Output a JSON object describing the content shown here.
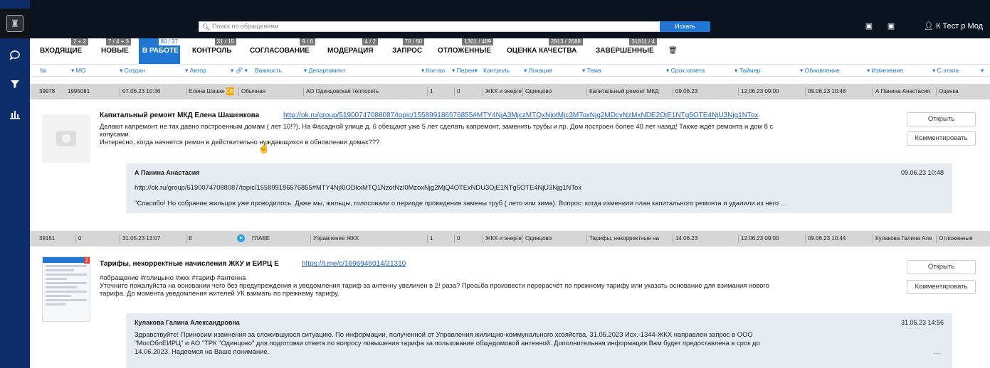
{
  "search": {
    "placeholder": "Поиск по обращениям",
    "button": "Искать"
  },
  "user": {
    "name": "К Тест р Мод"
  },
  "tabs": [
    {
      "label": "ВХОДЯЩИЕ",
      "badge": "2 + 2"
    },
    {
      "label": "НОВЫЕ",
      "badge": "7 / 4 + 3"
    },
    {
      "label": "В РАБОТЕ",
      "badge": "80 / 27",
      "active": true
    },
    {
      "label": "КОНТРОЛЬ",
      "badge": "31 / 15"
    },
    {
      "label": "СОГЛАСОВАНИЕ",
      "badge": "9 / 6"
    },
    {
      "label": "МОДЕРАЦИЯ",
      "badge": "4 / 2"
    },
    {
      "label": "ЗАПРОС",
      "badge": "70 / 60"
    },
    {
      "label": "ОТЛОЖЕННЫЕ",
      "badge": "1301 / 489"
    },
    {
      "label": "ОЦЕНКА КАЧЕСТВА",
      "badge": "2913 / 2688"
    },
    {
      "label": "ЗАВЕРШЕННЫЕ",
      "badge": "31811 / 4"
    }
  ],
  "columns": [
    "№",
    "МО",
    "Создан",
    "Автор",
    "Важность",
    "Департамент",
    "Кол-во",
    "Перен",
    "Контроль",
    "Локация",
    "Тема",
    "Срок ответа",
    "Таймер",
    "Обновление",
    "Изменение",
    "С этапа"
  ],
  "rows": [
    {
      "cells": [
        "39978",
        "1995081",
        "07.06.23 10:36",
        "Елена Шашен",
        "Обычная",
        "АО Одинцовская теплосеть",
        "1",
        "0",
        "ЖКХ и энергет",
        "Одинцово",
        "Капитальный ремонт МКД",
        "09.06.23",
        "12.06.23 09:00",
        "09.06.23 10:48",
        "А Панина Анастасия",
        "Оценка"
      ],
      "detail": {
        "title": "Капитальный ремонт МКД   Елена Шашенкова",
        "link": "http://ok.ru/group/51900747088087/topic/155899186576855#MTY4NjA3MjczMTQxNjotMjc3MToxNjg2MDcyNzMxNDE2OjE1NTg5OTE4NjU3Njg1NTox",
        "text1": "Делают капремонт не так давно построенным домам ( лет 10!?). На Фасадной улице д. 6 обещают уже 5 лет сделать капремонт, заменить трубы и пр. Дом построен более 40 лет назад! Также ждёт ремонта и дом 8 с",
        "text2": "копусами.",
        "text3": "Интересно, когда начнется ремон в действительно нуждающихся в обновлении домах???",
        "reply_author": "А Панина Анастасия",
        "reply_date": "09.06.23 10:48",
        "reply_link": "http://ok.ru/group/51900747088087/topic/155899186576855#MTY4NjI0ODkxMTQ1NzotNzI0MzoxNjg2MjQ4OTExNDU3OjE1NTg5OTE4NjU3Njg1NTox",
        "reply_text": "\"Спасибо! Но собрание жильцов уже проводилось. Даже мы, жильцы, голосовали о периоде проведения замены труб ( лето или зима). Вопрос: когда изменили план капитального ремонта и удалили из него   …"
      }
    },
    {
      "cells": [
        "39151",
        "0",
        "31.05.23 13:07",
        "Е",
        "ГЛАВЕ",
        "Управление ЖКХ",
        "1",
        "0",
        "ЖКХ и энергет",
        "Одинцово",
        "Тарифы, некорректные на",
        "14.06.23",
        "12.06.23 09:00",
        "09.06.23 10:44",
        "Кулакова Галина Але",
        "Отложенные"
      ],
      "detail": {
        "title": "Тарифы, некорректные начисления ЖКУ и ЕИРЦ   Е",
        "link": "https://t.me/c/1696946014/21310",
        "text1": "#обращение #голицыно #жкх #тариф #антенна",
        "text2": "Уточните пожалуйста на основании чего без предупреждения и уведомления тариф за антенну увеличен в 2! раза? Просьба произвести перерасчёт по прежнему тарифу или указать основание для взимания нового",
        "text3": "тарифа. До момента уведомления жителей УК взимать по прежнему тарифу.",
        "reply_author": "Кулакова Галина Александровна",
        "reply_date": "31.05.23 14:56",
        "reply_text1": "Здравствуйте! Приносим извинения за сложившуюся ситуацию. По информации, полученной от Управления жилищно-коммунального хозяйства, 31.05.2023 Исх.-1344-ЖКХ направлен запрос в ООО",
        "reply_text2": "\"МосОблЕИРЦ\" и АО \"ТРК \"Одинцово\" для подготовки ответа по вопросу повышения тарифа за пользование общедомовой антенной. Дополнительная информация Вам будет предоставлена в срок до",
        "reply_text3": "14.06.2023. Надеемся на Ваше понимание.",
        "thumb_badge": "2"
      }
    }
  ],
  "actions": {
    "open": "Открыть",
    "comment": "Комментировать"
  },
  "colors": {
    "accent": "#1f76d3",
    "rail": "#0d2d6b",
    "topbar": "#0b1320",
    "row": "#d6d6d6",
    "reply": "#e7ecf3"
  }
}
